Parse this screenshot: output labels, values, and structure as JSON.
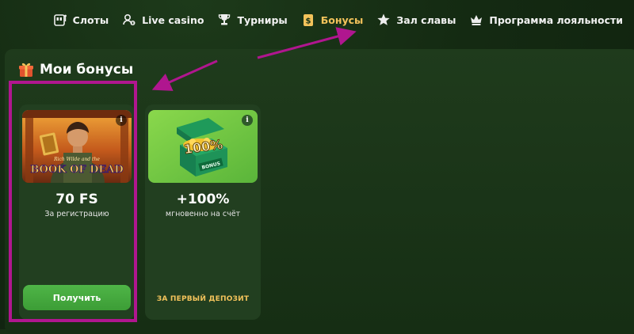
{
  "nav": {
    "items": [
      {
        "label": "Слоты",
        "icon": "slot-machine-icon",
        "active": false
      },
      {
        "label": "Live casino",
        "icon": "live-casino-icon",
        "active": false
      },
      {
        "label": "Турниры",
        "icon": "trophy-icon",
        "active": false
      },
      {
        "label": "Бонусы",
        "icon": "bonus-icon",
        "active": true
      },
      {
        "label": "Зал славы",
        "icon": "star-icon",
        "active": false
      },
      {
        "label": "Программа лояльности",
        "icon": "crown-icon",
        "active": false
      }
    ]
  },
  "bonuses": {
    "title": "Мои бонусы",
    "title_icon": "gift-icon",
    "cards": [
      {
        "value": "70 FS",
        "description": "За регистрацию",
        "button_label": "Получить",
        "image_text_top": "Rich Wilde and the",
        "image_text_main": "BOOK OF DEAD",
        "info": "i"
      },
      {
        "value": "+100%",
        "description": "мгновенно на счёт",
        "footer_label": "ЗА ПЕРВЫЙ ДЕПОЗИТ",
        "image_text_percent": "100%",
        "image_text_tag": "BONUS",
        "info": "i"
      }
    ]
  },
  "colors": {
    "accent_active": "#f3c35b",
    "button_green": "#45a83e",
    "highlight": "#b0168f"
  }
}
